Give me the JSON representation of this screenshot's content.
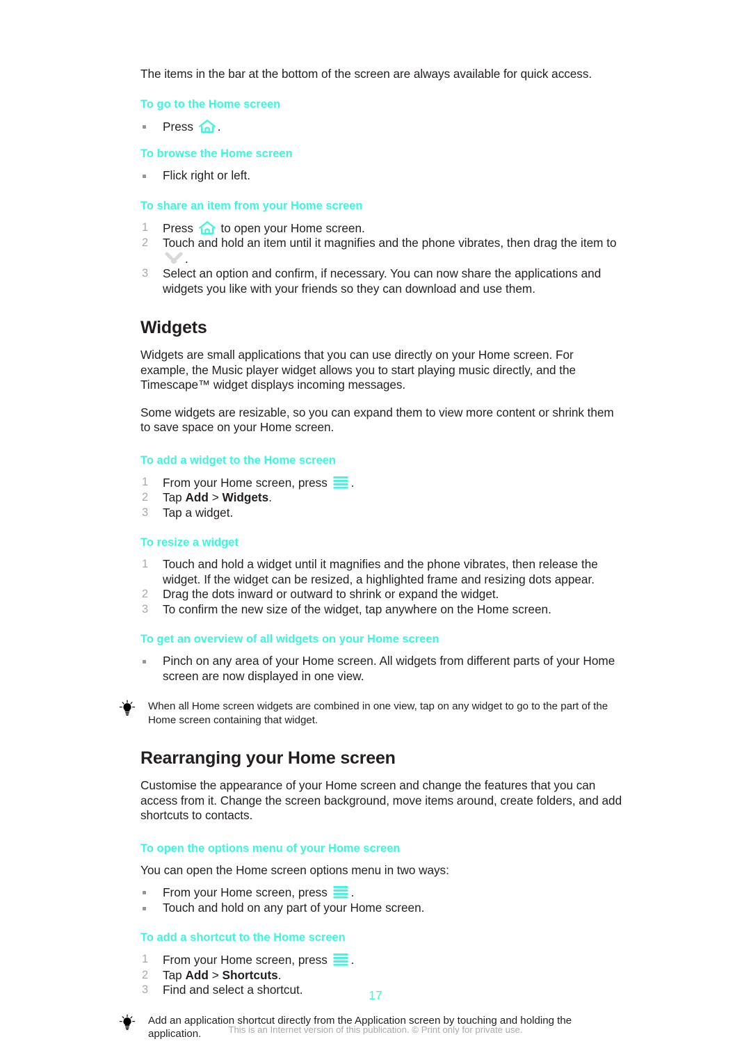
{
  "document": {
    "intro_paragraph": "The items in the bar at the bottom of the screen are always available for quick access.",
    "page_number": "17",
    "footer_note": "This is an Internet version of this publication. © Print only for private use."
  },
  "colors": {
    "accent_cyan": "#3EF5DD",
    "body_text": "#231F20",
    "marker_gray": "#A7A9AC",
    "footer_gray": "#A7A9AC"
  },
  "icons": {
    "home": "home-icon",
    "menu": "menu-icon",
    "share": "share-icon",
    "tip": "lightbulb-icon"
  },
  "sections": {
    "go_home": {
      "heading": "To go to the Home screen",
      "step_marker": "•",
      "text_before_icon": "Press ",
      "text_after_icon": "."
    },
    "browse_home": {
      "heading": "To browse the Home screen",
      "step_marker": "•",
      "step_text": "Flick right or left."
    },
    "share_item": {
      "heading": "To share an item from your Home screen",
      "step1_marker": "1",
      "step1_before_icon": "Press ",
      "step1_after_icon": " to open your Home screen.",
      "step2_marker": "2",
      "step2_before_icon": "Touch and hold an item until it magnifies and the phone vibrates, then drag the item to ",
      "step2_after_icon": ".",
      "step3_marker": "3",
      "step3_text": "Select an option and confirm, if necessary. You can now share the applications and widgets you like with your friends so they can download and use them."
    },
    "widgets": {
      "heading": "Widgets",
      "para1": "Widgets are small applications that you can use directly on your Home screen. For example, the Music player widget allows you to start playing music directly, and the Timescape™ widget displays incoming messages.",
      "para2": "Some widgets are resizable, so you can expand them to view more content or shrink them to save space on your Home screen."
    },
    "add_widget": {
      "heading": "To add a widget to the Home screen",
      "step1_marker": "1",
      "step1_before_icon": "From your Home screen, press ",
      "step1_after_icon": ".",
      "step2_marker": "2",
      "step2_prefix": "Tap ",
      "step2_bold1": "Add",
      "step2_mid": " > ",
      "step2_bold2": "Widgets",
      "step2_suffix": ".",
      "step3_marker": "3",
      "step3_text": "Tap a widget."
    },
    "resize_widget": {
      "heading": "To resize a widget",
      "step1_marker": "1",
      "step1_text": "Touch and hold a widget until it magnifies and the phone vibrates, then release the widget. If the widget can be resized, a highlighted frame and resizing dots appear.",
      "step2_marker": "2",
      "step2_text": "Drag the dots inward or outward to shrink or expand the widget.",
      "step3_marker": "3",
      "step3_text": "To confirm the new size of the widget, tap anywhere on the Home screen."
    },
    "overview_widgets": {
      "heading": "To get an overview of all widgets on your Home screen",
      "step_marker": "•",
      "step_text": "Pinch on any area of your Home screen. All widgets from different parts of your Home screen are now displayed in one view."
    },
    "tip_widgets": {
      "text": "When all Home screen widgets are combined in one view, tap on any widget to go to the part of the Home screen containing that widget."
    },
    "rearranging": {
      "heading": "Rearranging your Home screen",
      "para1": "Customise the appearance of your Home screen and change the features that you can access from it. Change the screen background, move items around, create folders, and add shortcuts to contacts."
    },
    "options_menu": {
      "heading": "To open the options menu of your Home screen",
      "intro": "You can open the Home screen options menu in two ways:",
      "step1_marker": "•",
      "step1_before_icon": "From your Home screen, press ",
      "step1_after_icon": ".",
      "step2_marker": "•",
      "step2_text": "Touch and hold on any part of your Home screen."
    },
    "add_shortcut": {
      "heading": "To add a shortcut to the Home screen",
      "step1_marker": "1",
      "step1_before_icon": "From your Home screen, press ",
      "step1_after_icon": ".",
      "step2_marker": "2",
      "step2_prefix": "Tap ",
      "step2_bold1": "Add",
      "step2_mid": " > ",
      "step2_bold2": "Shortcuts",
      "step2_suffix": ".",
      "step3_marker": "3",
      "step3_text": "Find and select a shortcut."
    },
    "tip_shortcut": {
      "text": "Add an application shortcut directly from the Application screen by touching and holding the application."
    }
  }
}
